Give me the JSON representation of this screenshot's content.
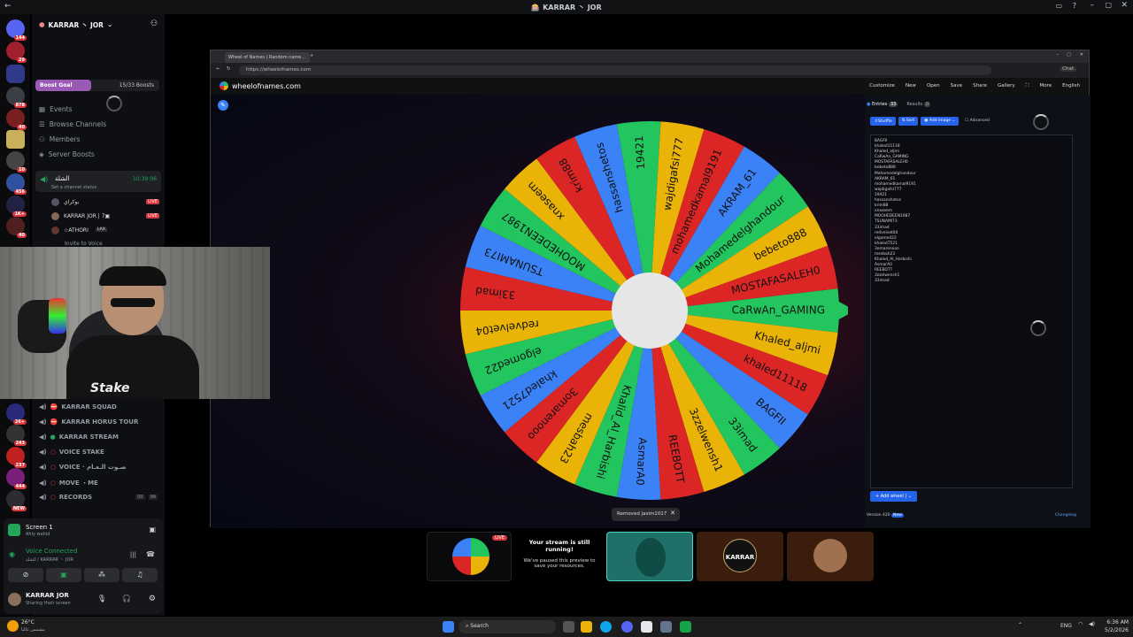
{
  "window": {
    "title": "🎰 KARRAR 丶 JOR"
  },
  "server": {
    "name": "KARRAR 丶 JOR",
    "boost_goal": "Boost Goal",
    "boost_count": "15/33 Boosts",
    "boost_progress": 0.45
  },
  "server_badges": [
    "144",
    "29",
    "878",
    "40",
    "10",
    "456",
    "1K+",
    "40",
    "26+",
    "243",
    "237",
    "444",
    "NEW"
  ],
  "nav": {
    "events": "Events",
    "browse": "Browse Channels",
    "members": "Members",
    "boosts": "Server Boosts"
  },
  "stage_channel": {
    "name": "الشلة",
    "timer": "10:39:06",
    "status": "Set a channel status"
  },
  "stage_users": [
    {
      "name": "بوكراي",
      "live": "LIVE"
    },
    {
      "name": "KARRAR JOR | 7▣",
      "live": "LIVE"
    },
    {
      "name": "☆ATHORI",
      "tag": "LAX"
    }
  ],
  "invite": "Invite to Voice",
  "voice_channels": [
    {
      "name": "KARRAR SQUAD"
    },
    {
      "name": "KARRAR HORUS TOUR"
    },
    {
      "name": "KARRAR STREAM"
    },
    {
      "name": "VOICE STAKE"
    },
    {
      "name": "VOICE · صـوت الـعـام"
    },
    {
      "name": "MOVE ・ME"
    },
    {
      "name": "RECORDS",
      "count": "00",
      "count2": "99"
    }
  ],
  "screen_share": {
    "title": "Screen 1",
    "sub": "Ahly wahid"
  },
  "voice_connected": {
    "title": "Voice Connected",
    "sub": "الشلة / KARRAR 丶 JOR"
  },
  "user": {
    "name": "KARRAR JOR",
    "status": "Sharing their screen"
  },
  "browser": {
    "tab": "Wheel of Names | Random name...",
    "url": "https://wheelofnames.com",
    "profile": "Chat"
  },
  "site": {
    "logo": "wheelofnames.com",
    "menu": [
      "Customize",
      "New",
      "Open",
      "Save",
      "Share",
      "Gallery",
      "",
      "More",
      "English"
    ]
  },
  "panel": {
    "tab_entries": "Entries",
    "entries_count": "33",
    "tab_results": "Results",
    "results_count": "0",
    "shuffle": "Shuffle",
    "sort": "Sort",
    "add_image": "Add image",
    "advanced": "Advanced",
    "add_wheel": "Add wheel",
    "version": "Version 420",
    "changelog": "Changelog",
    "new_badge": "New"
  },
  "entries": [
    "BAGFII",
    "khaled11118",
    "Khaled_aljmi",
    "CaRwAn_GAMING",
    "MOSTAFASALEH0",
    "bebeto888",
    "Mohamedelghandour",
    "AKRAM_61",
    "mohamedkamal9191",
    "wajdigafsi777",
    "19421",
    "hassanshetos",
    "krim88",
    "xnaseem",
    "MOOHEDEEN1987",
    "TSUNAMI73",
    "33imad",
    "redvelvet04",
    "elgomed22",
    "khaled7521",
    "3omarenooo",
    "mesbah23",
    "Khaled_Al_Harbishi",
    "AsmarA0",
    "REEBOTT",
    "3zzelwensh1",
    "33imad"
  ],
  "wheel_segments": [
    "CaRwAn_GAMING",
    "Khaled_aljmi",
    "khaled11118",
    "BAGFII",
    "33imad",
    "3zzelwensh1",
    "REEBOTT",
    "AsmarA0",
    "Khalid_Al_Harbishi",
    "mesbah23",
    "3omarenooo",
    "khaled7521",
    "elgomed22",
    "redvelvet04",
    "33imad",
    "TSUNAMI73",
    "MOOHEDEEN1987",
    "xnaseem",
    "krim88",
    "hassanshetos",
    "19421",
    "wajdigafsi777",
    "mohamedkamal9191",
    "AKRAM_61",
    "Mohamedelghandour",
    "bebeto888",
    "MOSTAFASALEH0"
  ],
  "wheel_colors": [
    "#22c55e",
    "#eab308",
    "#dc2626",
    "#3b82f6"
  ],
  "toast": "Removed jasim1017",
  "stream_notice": {
    "live": "LIVE",
    "title": "Your stream is still running!",
    "body": "We've paused this preview to save your resources."
  },
  "preview_names": [
    "KARRAR"
  ],
  "taskbar": {
    "weather": "26°C",
    "weather_sub": "مشمس غالبا",
    "search": "Search",
    "lang": "ENG",
    "time": "6:36 AM",
    "date": "5/2/2026"
  }
}
